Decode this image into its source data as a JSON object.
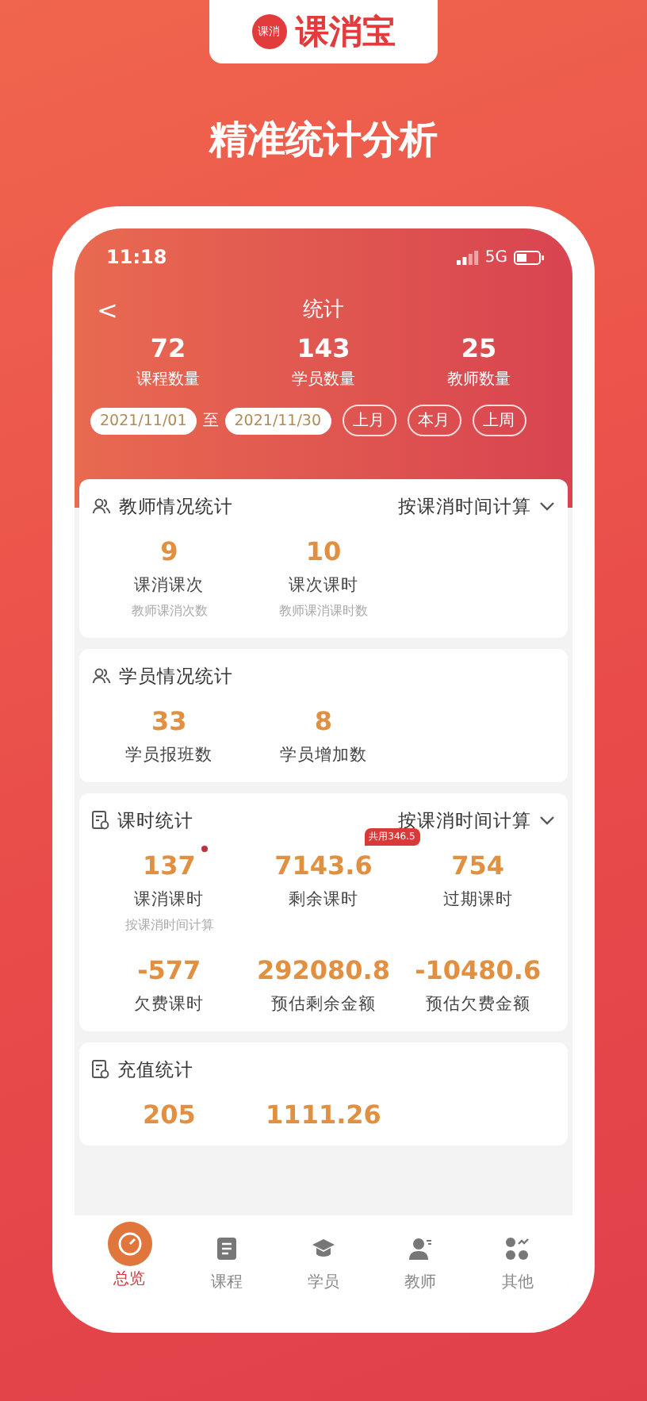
{
  "brand": {
    "badge": "课消",
    "name": "课消宝"
  },
  "headline": "精准统计分析",
  "status_bar": {
    "time": "11:18",
    "network": "5G"
  },
  "nav": {
    "back": "<",
    "title": "统计"
  },
  "summary": [
    {
      "value": "72",
      "label": "课程数量"
    },
    {
      "value": "143",
      "label": "学员数量"
    },
    {
      "value": "25",
      "label": "教师数量"
    }
  ],
  "date_range": {
    "start": "2021/11/01",
    "separator": "至",
    "end": "2021/11/30"
  },
  "quick_ranges": [
    "上月",
    "本月",
    "上周"
  ],
  "sections": [
    {
      "title": "教师情况统计",
      "dropdown": "按课消时间计算",
      "metrics": [
        {
          "value": "9",
          "label": "课消课次",
          "note": "教师课消次数"
        },
        {
          "value": "10",
          "label": "课次课时",
          "note": "教师课消课时数"
        }
      ]
    },
    {
      "title": "学员情况统计",
      "metrics": [
        {
          "value": "33",
          "label": "学员报班数"
        },
        {
          "value": "8",
          "label": "学员增加数"
        }
      ]
    },
    {
      "title": "课时统计",
      "dropdown": "按课消时间计算",
      "metrics": [
        {
          "value": "137",
          "label": "课消课时",
          "note": "按课消时间计算",
          "dot": true
        },
        {
          "value": "7143.6",
          "label": "剩余课时",
          "badge": "共用346.5"
        },
        {
          "value": "754",
          "label": "过期课时"
        },
        {
          "value": "-577",
          "label": "欠费课时"
        },
        {
          "value": "292080.8",
          "label": "预估剩余金额"
        },
        {
          "value": "-10480.6",
          "label": "预估欠费金额"
        }
      ]
    },
    {
      "title": "充值统计",
      "metrics": [
        {
          "value": "205"
        },
        {
          "value": "1111.26"
        }
      ]
    }
  ],
  "tabs": [
    {
      "label": "总览",
      "selected": true
    },
    {
      "label": "课程",
      "selected": false
    },
    {
      "label": "学员",
      "selected": false
    },
    {
      "label": "教师",
      "selected": false
    },
    {
      "label": "其他",
      "selected": false
    }
  ]
}
